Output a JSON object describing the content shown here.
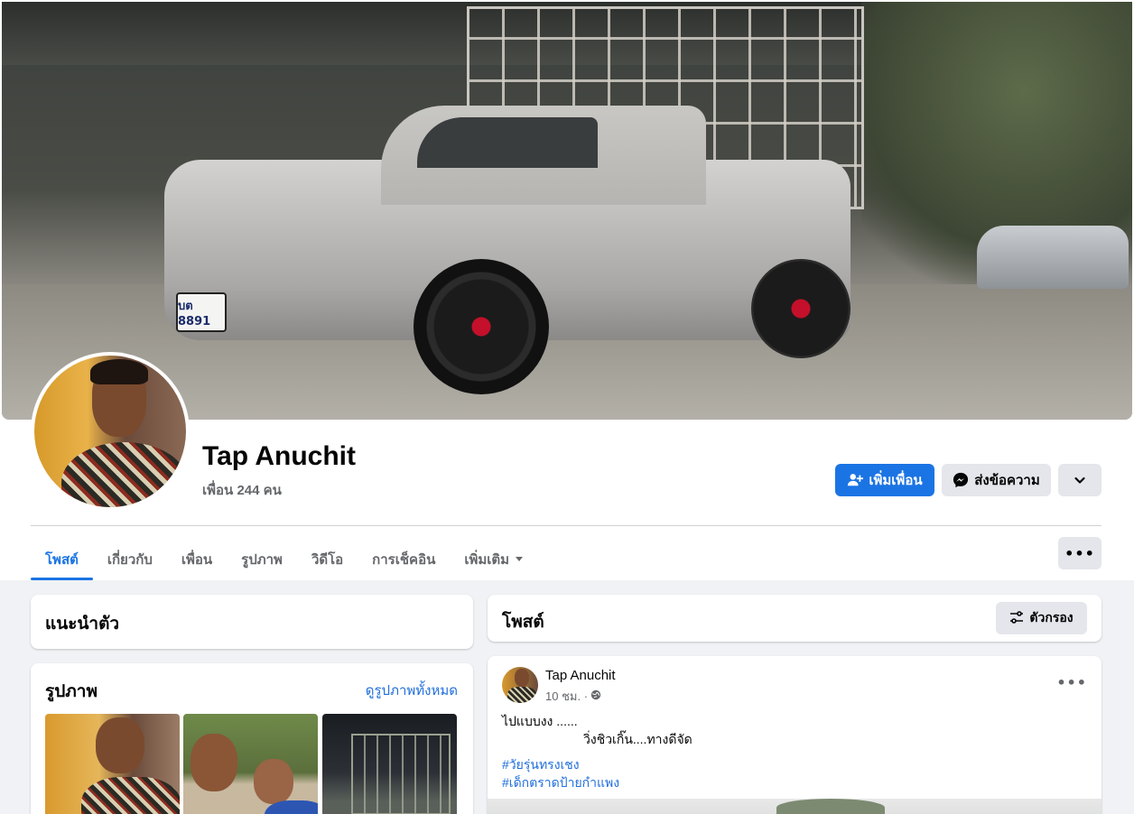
{
  "profile": {
    "name": "Tap Anuchit",
    "friends": "เพื่อน 244 คน",
    "plate": "บต 8891"
  },
  "actions": {
    "add_friend": "เพิ่มเพื่อน",
    "message": "ส่งข้อความ"
  },
  "tabs": [
    {
      "label": "โพสต์",
      "active": true
    },
    {
      "label": "เกี่ยวกับ"
    },
    {
      "label": "เพื่อน"
    },
    {
      "label": "รูปภาพ"
    },
    {
      "label": "วิดีโอ"
    },
    {
      "label": "การเช็คอิน"
    },
    {
      "label": "เพิ่มเติม"
    }
  ],
  "more_label": "•••",
  "intro": {
    "title": "แนะนำตัว"
  },
  "photos": {
    "title": "รูปภาพ",
    "see_all": "ดูรูปภาพทั้งหมด"
  },
  "posts_section": {
    "title": "โพสต์",
    "filter": "ตัวกรอง"
  },
  "post": {
    "author": "Tap Anuchit",
    "time": "10 ชม. ·",
    "more": "•••",
    "line1": "ไปแบบงง ......",
    "line2": "วิ่งชิวเกิ๊น....ทางดีจัด",
    "hashtag1": "#วัยรุ่นทรงเชง",
    "hashtag2": "#เด็กตราดป้ายกำแพง"
  },
  "colors": {
    "primary": "#1b74e4",
    "link": "#216fdb",
    "secondary_btn": "#e4e6eb",
    "muted_text": "#65676b",
    "page_bg": "#f0f2f5"
  },
  "icons": {
    "add_friend": "person-plus-icon",
    "message": "messenger-icon",
    "chevron": "chevron-down-icon",
    "filter": "sliders-icon",
    "audience": "globe-icon"
  }
}
